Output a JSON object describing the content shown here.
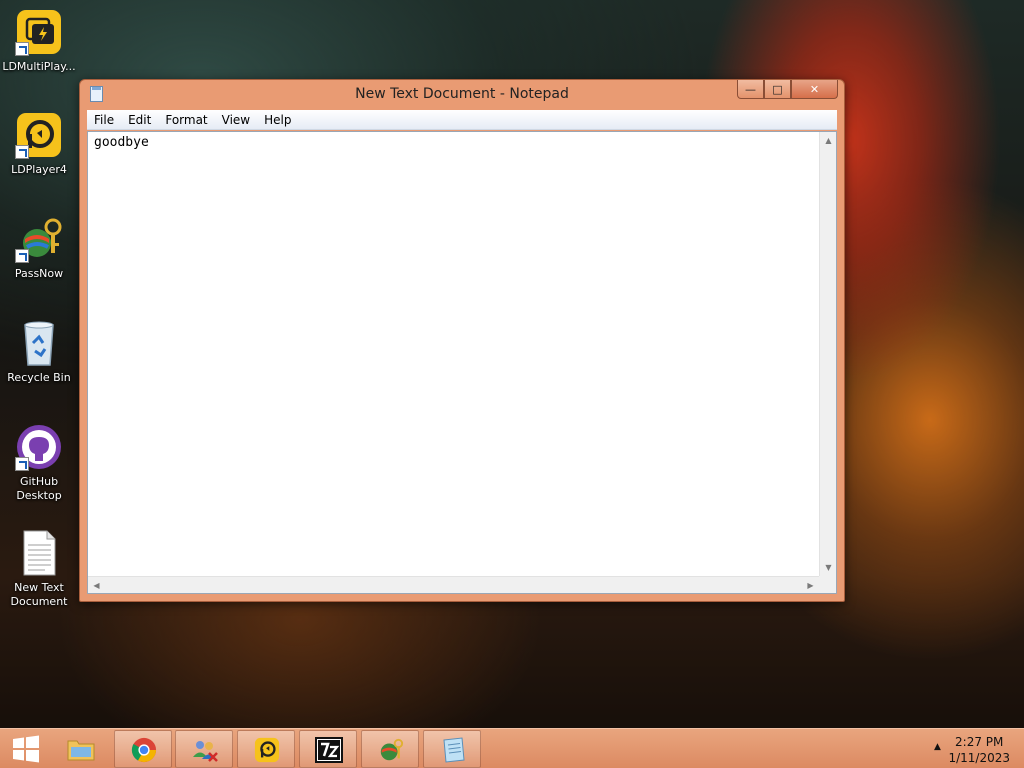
{
  "desktop": {
    "icons": [
      {
        "label": "LDMultiPlay..."
      },
      {
        "label": "LDPlayer4"
      },
      {
        "label": "PassNow"
      },
      {
        "label": "Recycle Bin"
      },
      {
        "label": "GitHub Desktop"
      },
      {
        "label": "New Text Document"
      }
    ]
  },
  "window": {
    "title": "New Text Document - Notepad",
    "controls": {
      "minimize": "—",
      "maximize": "□",
      "close": "✕"
    },
    "menu": [
      "File",
      "Edit",
      "Format",
      "View",
      "Help"
    ],
    "content": "goodbye"
  },
  "taskbar": {
    "items": [
      "start",
      "file-explorer",
      "chrome",
      "users-app",
      "ldplayer",
      "7zip",
      "passnow",
      "notepad"
    ],
    "tray": {
      "time": "2:27 PM",
      "date": "1/11/2023",
      "arrow": "▲"
    }
  },
  "colors": {
    "accent": "#e99b73",
    "taskbar": "#dc8a62"
  }
}
